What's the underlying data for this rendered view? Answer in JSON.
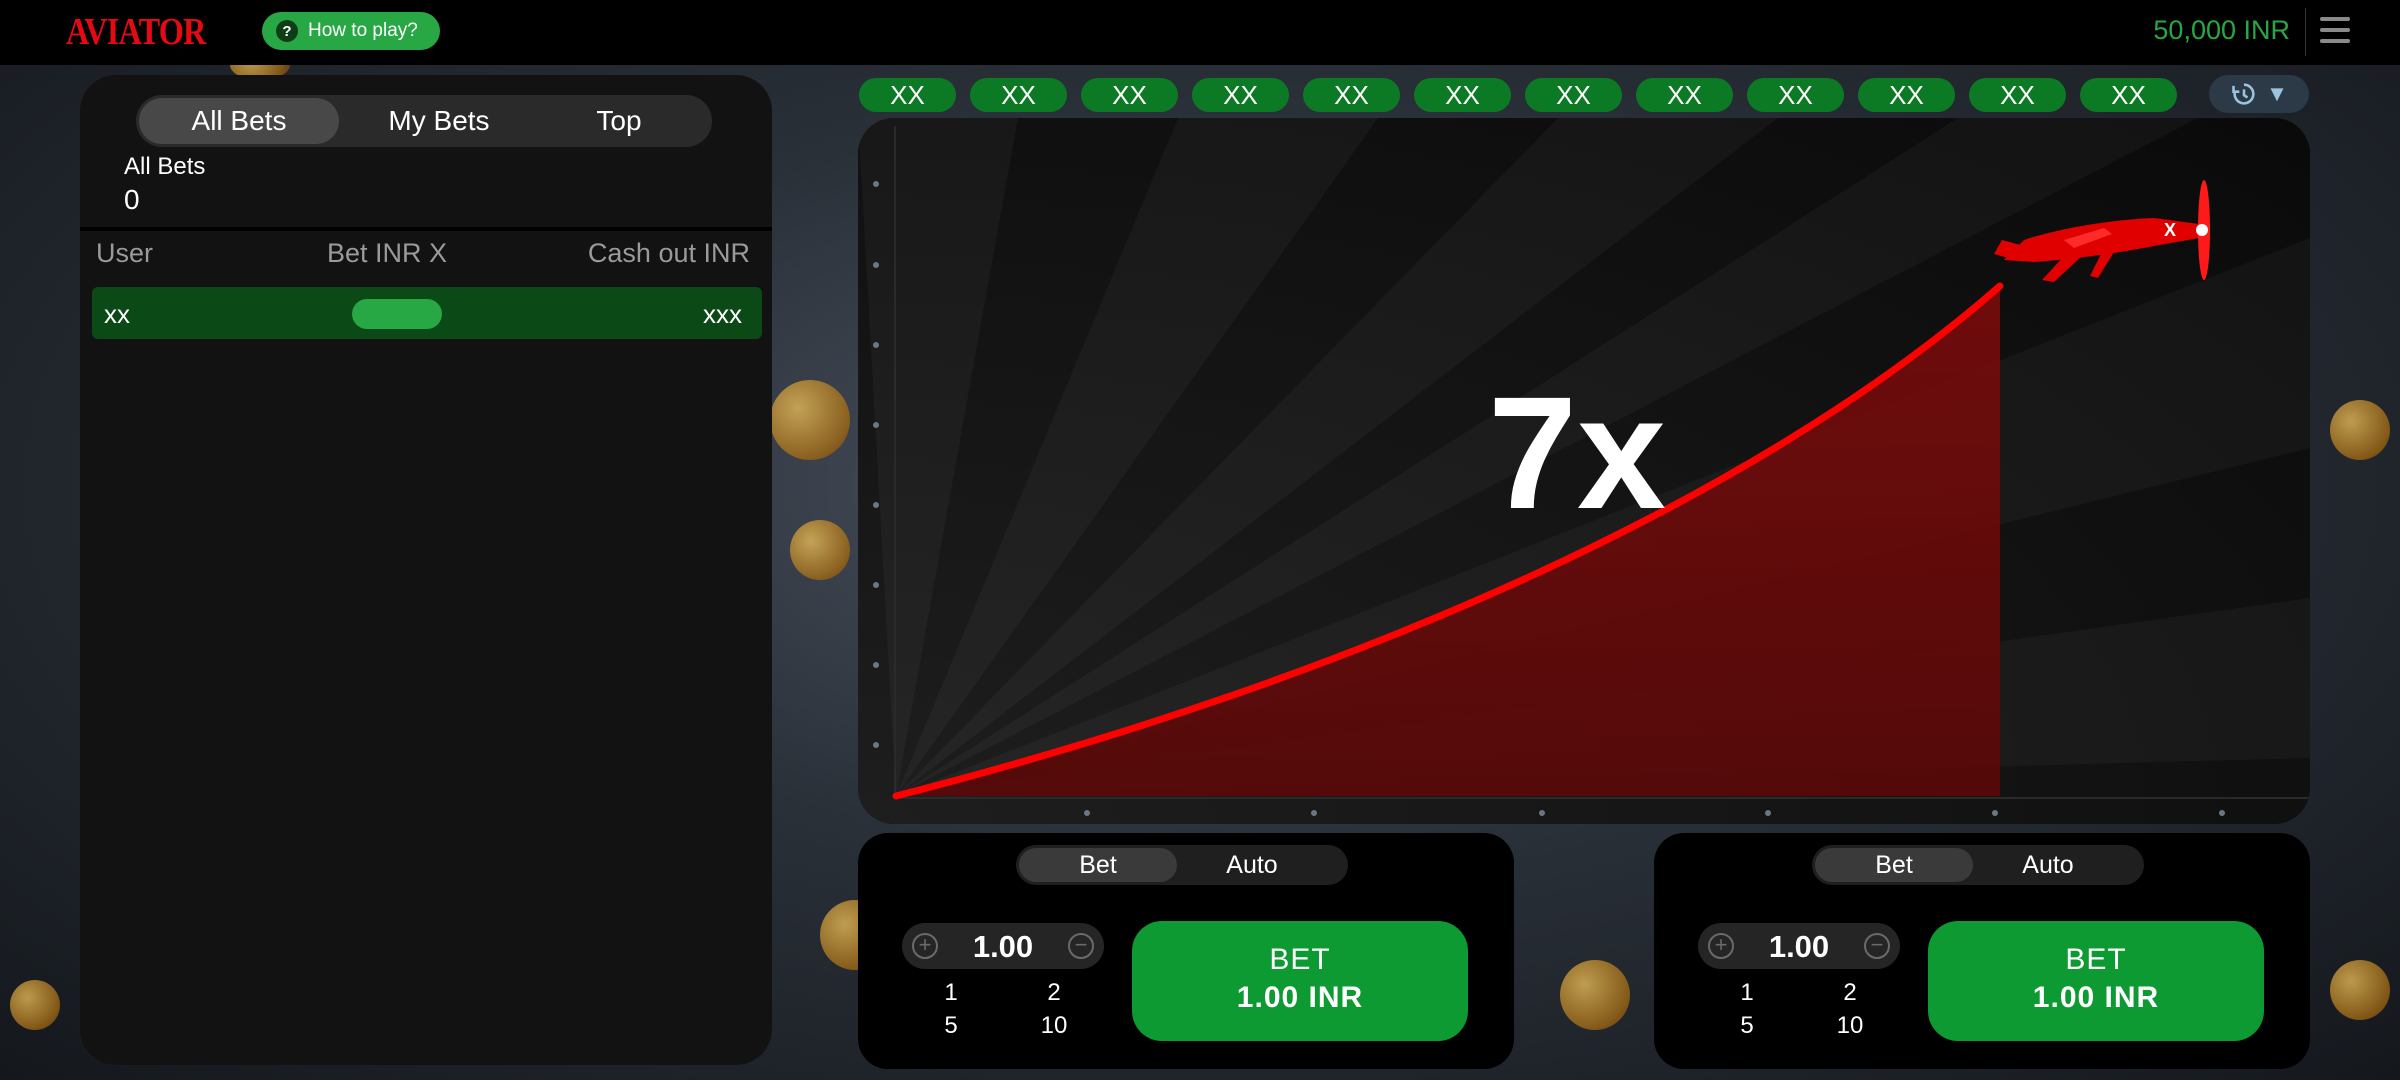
{
  "header": {
    "logo": "AVIATOR",
    "how_to_play": "How to play?",
    "how_to_play_icon": "?",
    "balance": "50,000 INR"
  },
  "bets_panel": {
    "tabs": [
      "All Bets",
      "My Bets",
      "Top"
    ],
    "active_tab": "All Bets",
    "all_bets_label": "All Bets",
    "all_bets_count": "0",
    "columns": [
      "User",
      "Bet INR X",
      "Cash out INR"
    ],
    "rows": [
      {
        "user": "xx",
        "cash_out": "xxx"
      }
    ]
  },
  "history": [
    "XX",
    "XX",
    "XX",
    "XX",
    "XX",
    "XX",
    "XX",
    "XX",
    "XX",
    "XX",
    "XX",
    "XX"
  ],
  "history_button": {
    "icon": "history-icon",
    "arrow": "▼"
  },
  "game": {
    "multiplier": "7x",
    "curve_color": "#ff0000",
    "plane_color": "#e00000"
  },
  "bet_controls": [
    {
      "toggle": [
        "Bet",
        "Auto"
      ],
      "active": "Bet",
      "amount": "1.00",
      "quick": [
        "1",
        "2",
        "5",
        "10"
      ],
      "button_line1": "BET",
      "button_line2": "1.00 INR"
    },
    {
      "toggle": [
        "Bet",
        "Auto"
      ],
      "active": "Bet",
      "amount": "1.00",
      "quick": [
        "1",
        "2",
        "5",
        "10"
      ],
      "button_line1": "BET",
      "button_line2": "1.00 INR"
    }
  ],
  "colors": {
    "accent_green": "#28a745",
    "logo_red": "#e50914",
    "chip_green": "#0c7a24"
  }
}
